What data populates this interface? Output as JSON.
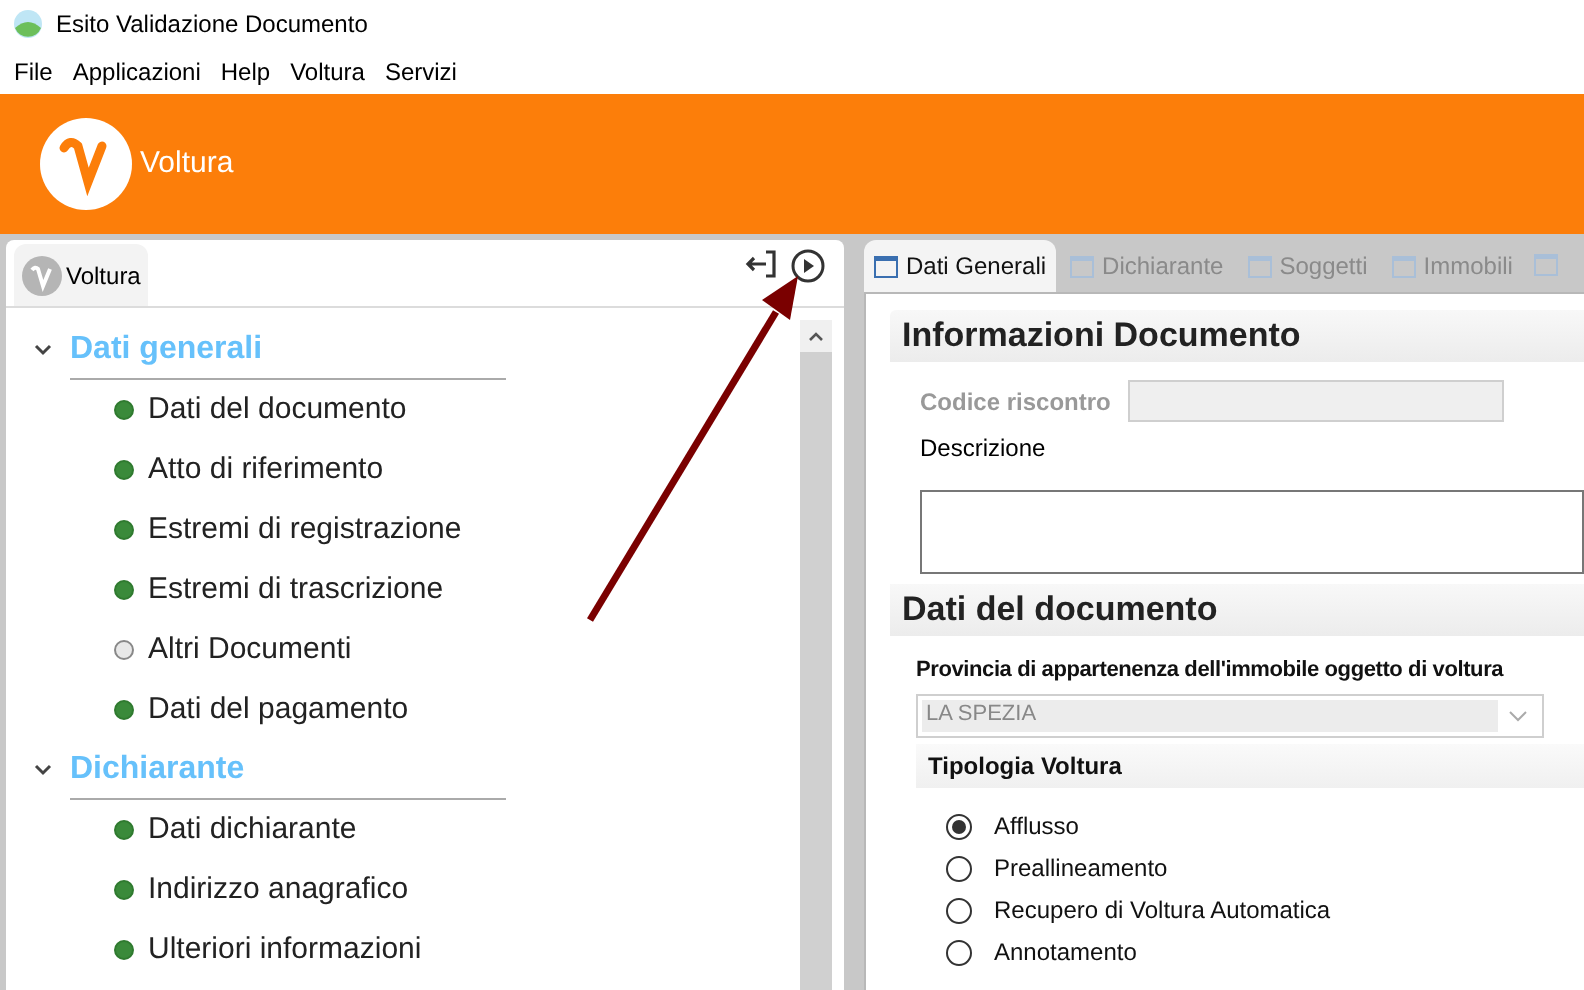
{
  "window": {
    "title": "Esito Validazione Documento"
  },
  "menu": [
    "File",
    "Applicazioni",
    "Help",
    "Voltura",
    "Servizi"
  ],
  "banner": {
    "title": "Voltura"
  },
  "left_panel": {
    "tab": "Voltura",
    "tree": [
      {
        "label": "Dati generali",
        "expanded": true,
        "children": [
          {
            "label": "Dati del documento",
            "complete": true
          },
          {
            "label": "Atto di riferimento",
            "complete": true
          },
          {
            "label": "Estremi di registrazione",
            "complete": true
          },
          {
            "label": "Estremi di trascrizione",
            "complete": true
          },
          {
            "label": "Altri Documenti",
            "complete": false
          },
          {
            "label": "Dati del pagamento",
            "complete": true
          }
        ]
      },
      {
        "label": "Dichiarante",
        "expanded": true,
        "children": [
          {
            "label": "Dati dichiarante",
            "complete": true
          },
          {
            "label": "Indirizzo anagrafico",
            "complete": true
          },
          {
            "label": "Ulteriori informazioni",
            "complete": true
          }
        ]
      }
    ]
  },
  "tabs": [
    {
      "label": "Dati Generali",
      "selected": true
    },
    {
      "label": "Dichiarante",
      "selected": false
    },
    {
      "label": "Soggetti",
      "selected": false
    },
    {
      "label": "Immobili",
      "selected": false
    }
  ],
  "informazioni_documento": {
    "title": "Informazioni Documento",
    "codice_riscontro": {
      "label": "Codice riscontro",
      "disabled": true
    },
    "descrizione": {
      "label": "Descrizione"
    }
  },
  "dati_documento": {
    "title": "Dati del documento",
    "provincia": {
      "label": "Provincia di appartenenza dell'immobile oggetto di voltura",
      "value": "LA SPEZIA"
    },
    "tipologia": {
      "title": "Tipologia Voltura",
      "options": [
        {
          "label": "Afflusso",
          "selected": true
        },
        {
          "label": "Preallineamento",
          "selected": false
        },
        {
          "label": "Recupero di Voltura Automatica",
          "selected": false
        },
        {
          "label": "Annotamento",
          "selected": false
        }
      ]
    }
  }
}
